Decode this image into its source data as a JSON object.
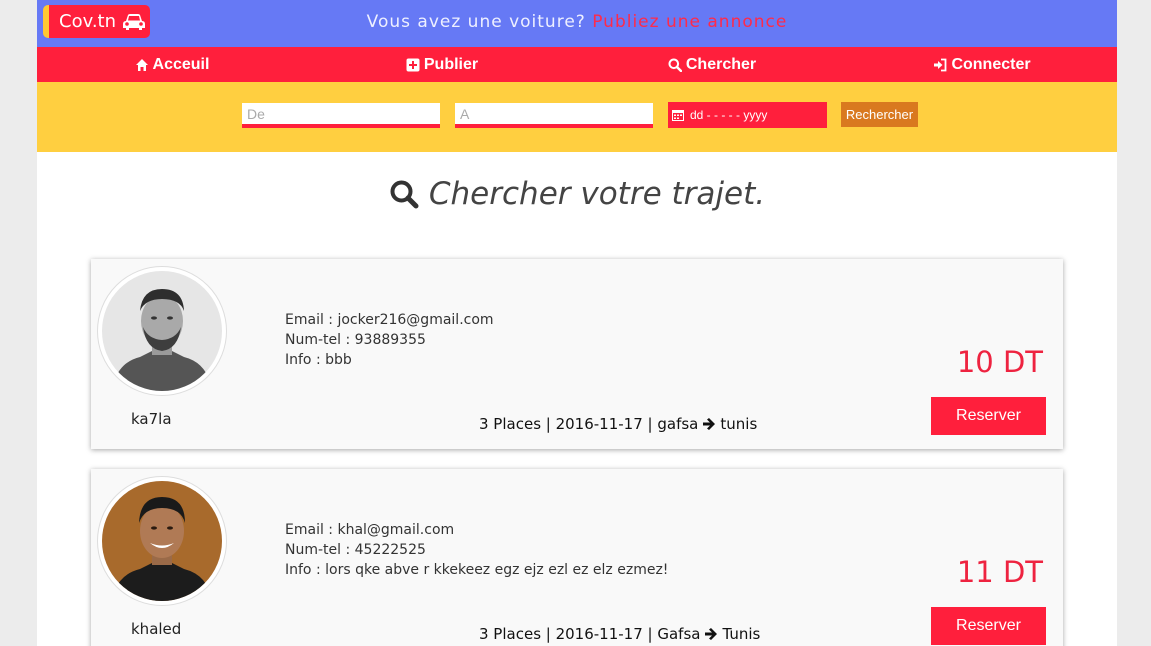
{
  "brand": {
    "logo_text": "Cov.tn",
    "icon": "car-icon"
  },
  "banner": {
    "question": "Vous avez une voiture?",
    "link": "Publiez une annonce"
  },
  "nav": {
    "items": [
      {
        "label": "Acceuil",
        "icon": "home-icon"
      },
      {
        "label": "Publier",
        "icon": "plus-square-icon"
      },
      {
        "label": "Chercher",
        "icon": "search-icon"
      },
      {
        "label": "Connecter",
        "icon": "sign-in-icon"
      }
    ]
  },
  "search": {
    "from_placeholder": "De",
    "to_placeholder": "A",
    "date_placeholder": "dd - - - - - yyyy",
    "button": "Rechercher"
  },
  "heading": {
    "text": "Chercher votre trajet.",
    "icon": "search-icon"
  },
  "rides": [
    {
      "user": "ka7la",
      "email_line": "Email : jocker216@gmail.com",
      "tel_line": "Num-tel : 93889355",
      "info_line": "Info : bbb",
      "trip_prefix": "3 Places | 2016-11-17 | gafsa",
      "trip_dest": "tunis",
      "price": "10 DT",
      "button": "Reserver"
    },
    {
      "user": "khaled",
      "email_line": "Email : khal@gmail.com",
      "tel_line": "Num-tel : 45222525",
      "info_line": "Info : lors qke abve r kkekeez egz ejz ezl ez elz ezmez!",
      "trip_prefix": "3 Places | 2016-11-17 | Gafsa",
      "trip_dest": "Tunis",
      "price": "11 DT",
      "button": "Reserver"
    }
  ],
  "colors": {
    "banner": "#6679f5",
    "nav": "#ff1f3c",
    "search_bar": "#ffcf40",
    "accent_red": "#ff1f3c",
    "search_button": "#d9791f"
  }
}
